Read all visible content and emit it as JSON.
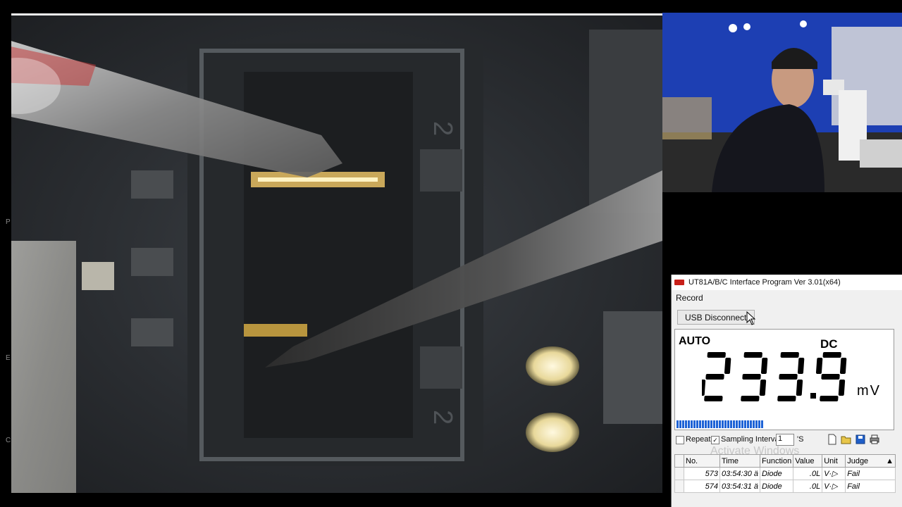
{
  "app": {
    "title": "UT81A/B/C Interface Program Ver 3.01(x64)",
    "menu": [
      "Record"
    ],
    "usb_button": "USB Disconnect"
  },
  "display": {
    "range_mode": "AUTO",
    "coupling": "DC",
    "value": "233.9",
    "unit": "mV",
    "bargraph_level": 0.53
  },
  "controls": {
    "repeat_label": "Repeat",
    "repeat_checked": false,
    "sampling_checked": true,
    "sampling_label": "Sampling Interval",
    "sampling_value": "1",
    "sampling_unit": "'S"
  },
  "table": {
    "columns": [
      "No.",
      "Time",
      "Function",
      "Value",
      "Unit",
      "Judge"
    ],
    "rows": [
      {
        "no": "573",
        "time": "03:54:30 ä",
        "function": "Diode",
        "value": ".0L",
        "unit": "V·▷",
        "judge": "Fail"
      },
      {
        "no": "574",
        "time": "03:54:31 ä",
        "function": "Diode",
        "value": ".0L",
        "unit": "V·▷",
        "judge": "Fail"
      }
    ]
  },
  "watermark": "Activate Windows",
  "side_letters": [
    "P",
    "E",
    "C"
  ],
  "colors": {
    "logo_red": "#c8201a",
    "bargraph_blue": "#1e63d6",
    "cam_blue": "#1a3aa8"
  }
}
